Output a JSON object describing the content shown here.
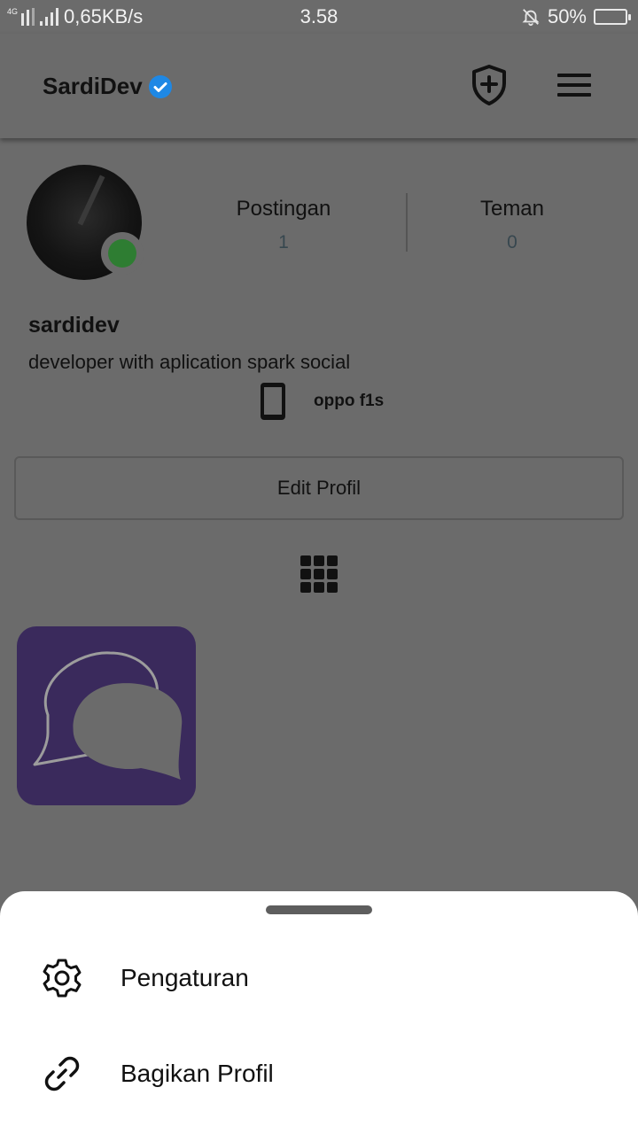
{
  "status_bar": {
    "network_type": "4G",
    "network_speed": "0,65KB/s",
    "time": "3.58",
    "battery_percent": "50%",
    "battery_level": 0.5,
    "battery_color": "#4caf50",
    "icons": [
      "signal-icon",
      "mute-bell-icon",
      "battery-icon"
    ]
  },
  "app_bar": {
    "title": "SardiDev",
    "verified_color": "#1e88e5",
    "icons": [
      "verified-badge-icon",
      "shield-plus-icon",
      "hamburger-menu-icon"
    ]
  },
  "profile": {
    "online_color": "#2e7d32",
    "stats": [
      {
        "label": "Postingan",
        "value": "1"
      },
      {
        "label": "Teman",
        "value": "0"
      }
    ],
    "username": "sardidev",
    "bio": "developer with aplication spark social",
    "device": "oppo f1s",
    "edit_button": "Edit Profil"
  },
  "posts": {
    "view_icon": "grid-icon",
    "items": [
      {
        "icon": "chat-bubbles-icon",
        "background": "#3a2a5c"
      }
    ]
  },
  "bottom_sheet": {
    "items": [
      {
        "label": "Pengaturan",
        "icon": "gear-icon"
      },
      {
        "label": "Bagikan Profil",
        "icon": "link-icon"
      }
    ]
  }
}
